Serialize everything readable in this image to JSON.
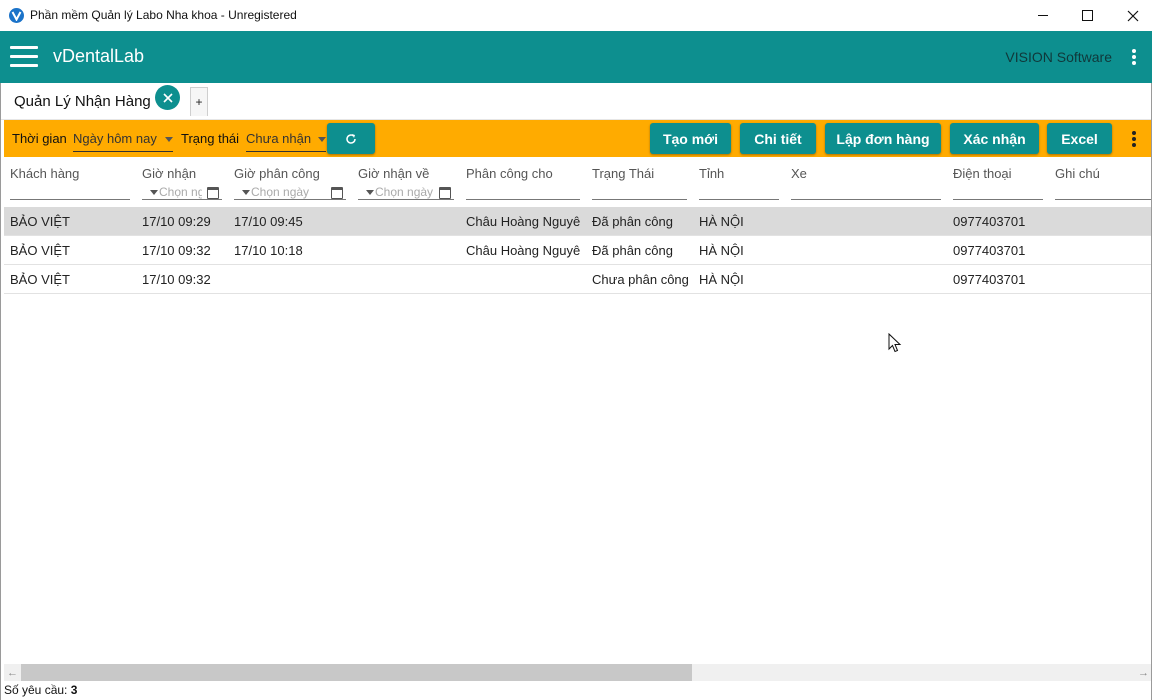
{
  "window": {
    "title": "Phần mềm Quản lý Labo Nha khoa - Unregistered",
    "minimize_icon": "minimize-icon",
    "maximize_icon": "maximize-icon",
    "close_icon": "close-icon"
  },
  "appbar": {
    "app_name": "vDentalLab",
    "vendor": "VISION Software",
    "color": "#0d8f8f"
  },
  "tabs": {
    "active_label": "Quản Lý Nhận Hàng",
    "add_label": "+"
  },
  "toolbar": {
    "color": "#ffab00",
    "time_label": "Thời gian",
    "time_value": "Ngày hôm nay",
    "status_label": "Trạng thái",
    "status_value": "Chưa nhận",
    "buttons": {
      "create": "Tạo mới",
      "detail": "Chi tiết",
      "make_order": "Lập đơn hàng",
      "confirm": "Xác nhận",
      "excel": "Excel"
    }
  },
  "grid": {
    "columns": {
      "customer": "Khách hàng",
      "received_time": "Giờ nhận",
      "assigned_time": "Giờ phân công",
      "returned_time": "Giờ nhận về",
      "assigned_to": "Phân công cho",
      "status": "Trạng Thái",
      "province": "Tỉnh",
      "vehicle": "Xe",
      "phone": "Điện thoại",
      "note": "Ghi chú"
    },
    "date_placeholders": {
      "received_time": "Chọn ngày",
      "assigned_time": "Chọn ngày",
      "returned_time": "Chọn ngày"
    },
    "rows": [
      {
        "customer": "BẢO VIỆT",
        "received_time": "17/10 09:29",
        "assigned_time": "17/10 09:45",
        "returned_time": "",
        "assigned_to": "Châu Hoàng Nguyên",
        "status": "Đã phân công",
        "province": "HÀ NỘI",
        "vehicle": "",
        "phone": "0977403701",
        "note": ""
      },
      {
        "customer": "BẢO VIỆT",
        "received_time": "17/10 09:32",
        "assigned_time": "17/10 10:18",
        "returned_time": "",
        "assigned_to": "Châu Hoàng Nguyên",
        "status": "Đã phân công",
        "province": "HÀ NỘI",
        "vehicle": "",
        "phone": "0977403701",
        "note": ""
      },
      {
        "customer": "BẢO VIỆT",
        "received_time": "17/10 09:32",
        "assigned_time": "",
        "returned_time": "",
        "assigned_to": "",
        "status": "Chưa phân công",
        "province": "HÀ NỘI",
        "vehicle": "",
        "phone": "0977403701",
        "note": ""
      }
    ],
    "selected_row": 0
  },
  "status_bar": {
    "count_label": "Số yêu cầu:",
    "count_value": "3"
  }
}
